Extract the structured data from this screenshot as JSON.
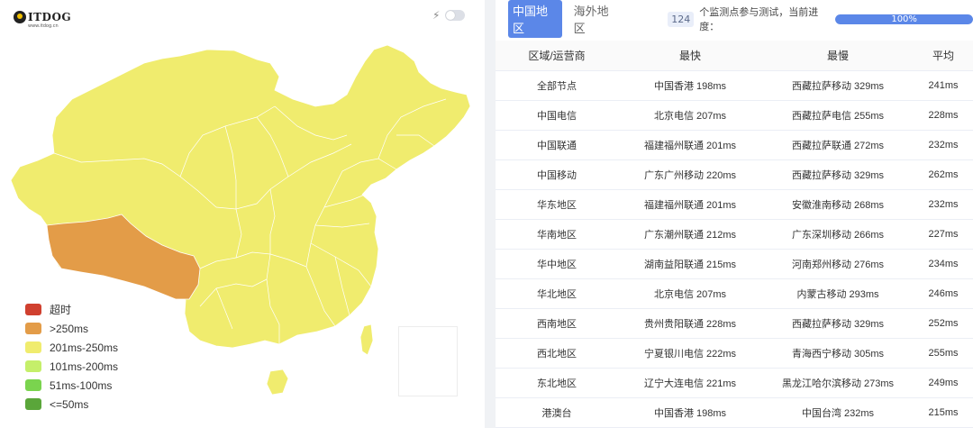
{
  "logo": {
    "text": "ITDOG",
    "subtext": "www.itdog.cn"
  },
  "map": {
    "regions": {
      "tibet": {
        "latency_class": ">250ms",
        "color": "#e39c48"
      },
      "mainland": {
        "latency_class": "201ms-250ms",
        "color": "#f0ec6e"
      }
    },
    "border_color": "#ffffff"
  },
  "legend": [
    {
      "label": "超时",
      "color": "#d0402f"
    },
    {
      "label": ">250ms",
      "color": "#e39c48"
    },
    {
      "label": "201ms-250ms",
      "color": "#f0ec6e"
    },
    {
      "label": "101ms-200ms",
      "color": "#c5ef6a"
    },
    {
      "label": "51ms-100ms",
      "color": "#7ad44e"
    },
    {
      "label": "<=50ms",
      "color": "#5aa63a"
    }
  ],
  "tabs": [
    {
      "label": "中国地区",
      "active": true
    },
    {
      "label": "海外地区",
      "active": false
    }
  ],
  "status": {
    "count": "124",
    "text": "个监测点参与测试，当前进度：",
    "progress_label": "100%",
    "progress_value": 1.0
  },
  "table": {
    "headers": [
      "区域/运营商",
      "最快",
      "最慢",
      "平均"
    ],
    "rows": [
      [
        "全部节点",
        "中国香港 198ms",
        "西藏拉萨移动 329ms",
        "241ms"
      ],
      [
        "中国电信",
        "北京电信 207ms",
        "西藏拉萨电信 255ms",
        "228ms"
      ],
      [
        "中国联通",
        "福建福州联通 201ms",
        "西藏拉萨联通 272ms",
        "232ms"
      ],
      [
        "中国移动",
        "广东广州移动 220ms",
        "西藏拉萨移动 329ms",
        "262ms"
      ],
      [
        "华东地区",
        "福建福州联通 201ms",
        "安徽淮南移动 268ms",
        "232ms"
      ],
      [
        "华南地区",
        "广东潮州联通 212ms",
        "广东深圳移动 266ms",
        "227ms"
      ],
      [
        "华中地区",
        "湖南益阳联通 215ms",
        "河南郑州移动 276ms",
        "234ms"
      ],
      [
        "华北地区",
        "北京电信 207ms",
        "内蒙古移动 293ms",
        "246ms"
      ],
      [
        "西南地区",
        "贵州贵阳联通 228ms",
        "西藏拉萨移动 329ms",
        "252ms"
      ],
      [
        "西北地区",
        "宁夏银川电信 222ms",
        "青海西宁移动 305ms",
        "255ms"
      ],
      [
        "东北地区",
        "辽宁大连电信 221ms",
        "黑龙江哈尔滨移动 273ms",
        "249ms"
      ],
      [
        "港澳台",
        "中国香港 198ms",
        "中国台湾 232ms",
        "215ms"
      ]
    ]
  }
}
